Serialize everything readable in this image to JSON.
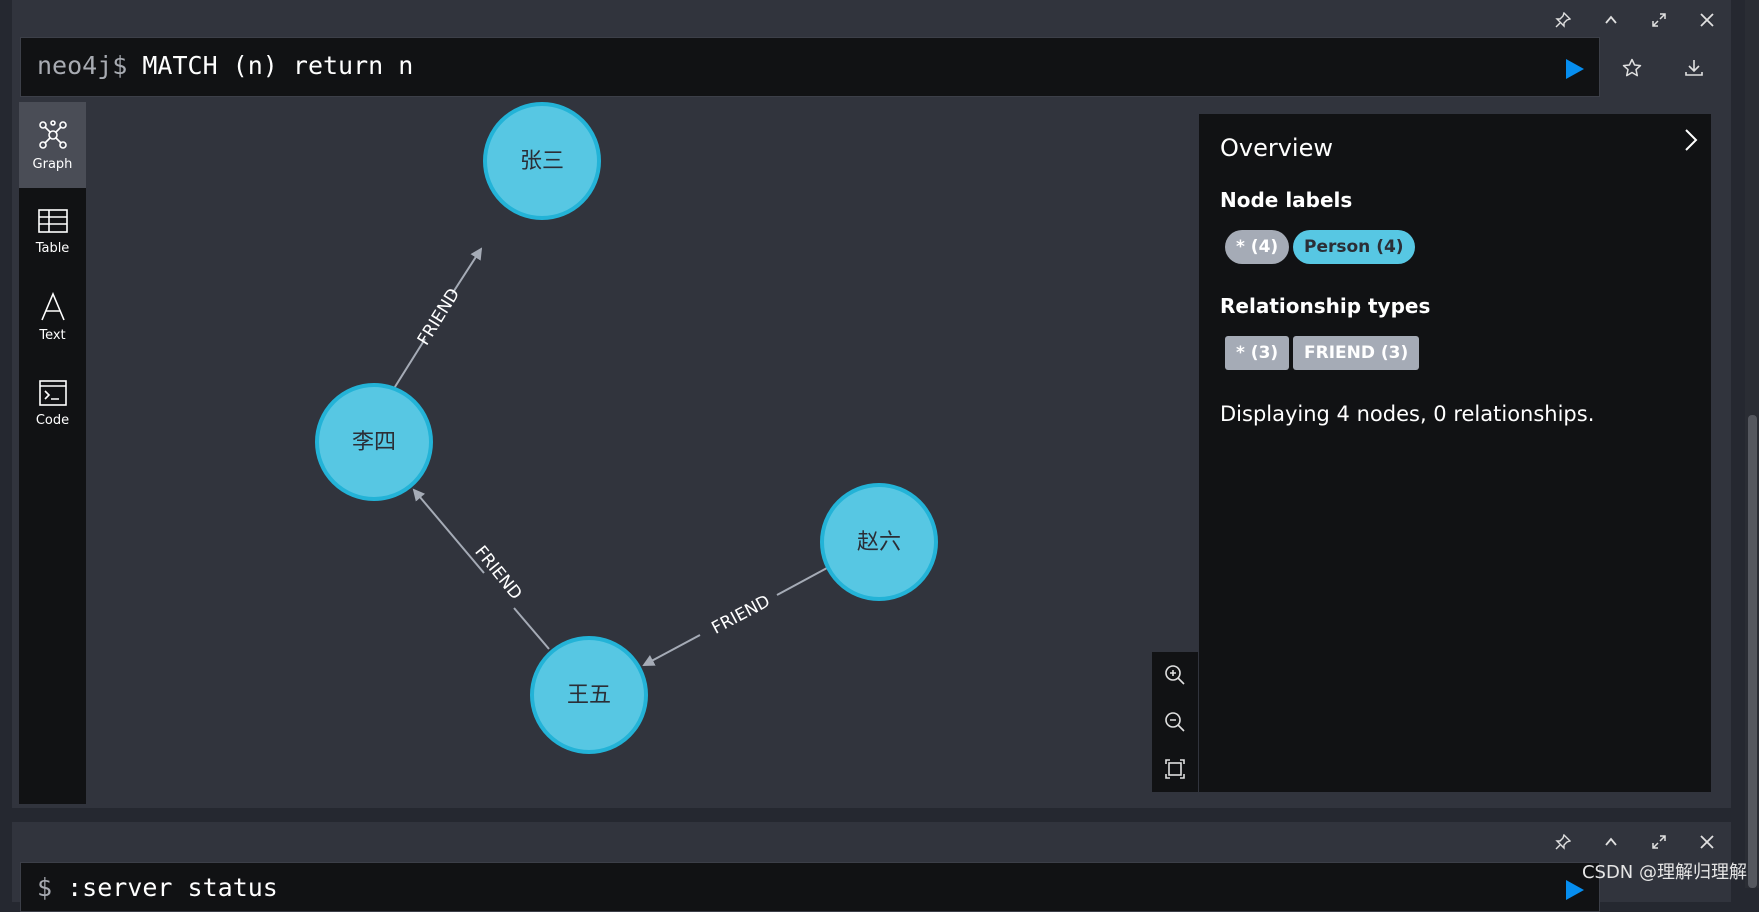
{
  "frame1": {
    "prompt": "neo4j$",
    "query": "MATCH (n) return n",
    "view_tabs": [
      {
        "label": "Graph",
        "icon": "graph-icon",
        "active": true
      },
      {
        "label": "Table",
        "icon": "table-icon",
        "active": false
      },
      {
        "label": "Text",
        "icon": "text-icon",
        "active": false
      },
      {
        "label": "Code",
        "icon": "code-icon",
        "active": false
      }
    ],
    "graph": {
      "nodes": [
        {
          "id": "n1",
          "label": "张三"
        },
        {
          "id": "n2",
          "label": "李四"
        },
        {
          "id": "n3",
          "label": "王五"
        },
        {
          "id": "n4",
          "label": "赵六"
        }
      ],
      "relationships": [
        {
          "from": "n2",
          "to": "n1",
          "type": "FRIEND"
        },
        {
          "from": "n3",
          "to": "n2",
          "type": "FRIEND"
        },
        {
          "from": "n4",
          "to": "n3",
          "type": "FRIEND"
        }
      ]
    },
    "overview": {
      "title": "Overview",
      "node_labels_heading": "Node labels",
      "node_labels": [
        "* (4)",
        "Person (4)"
      ],
      "relationship_types_heading": "Relationship types",
      "relationship_types": [
        "* (3)",
        "FRIEND (3)"
      ],
      "status": "Displaying 4 nodes, 0 relationships."
    }
  },
  "frame2": {
    "prompt": "$",
    "query": ":server status"
  },
  "watermark": "CSDN @理解归理解",
  "colors": {
    "node_fill": "#57c7e3",
    "node_stroke": "#23b3d7",
    "run_button": "#068ef0",
    "person_pill": "#57c7e3",
    "neutral_pill": "#a5abb6"
  }
}
